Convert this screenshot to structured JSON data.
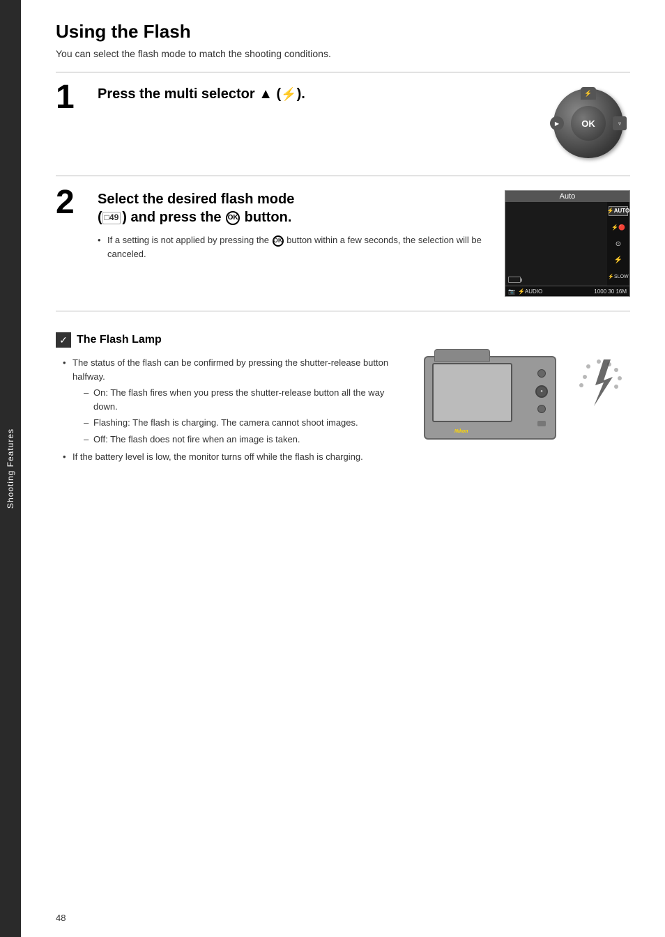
{
  "page": {
    "number": "48",
    "sidebar_label": "Shooting Features"
  },
  "title": "Using the Flash",
  "intro": "You can select the flash mode to match the shooting conditions.",
  "step1": {
    "number": "1",
    "heading": "Press the multi selector ▲ (⚡).",
    "dial": {
      "ok_label": "OK",
      "flash_symbol": "⚡"
    }
  },
  "step2": {
    "number": "2",
    "heading_line1": "Select the desired flash mode",
    "heading_line2": "(□49) and press the ⓪K button.",
    "note": "If a setting is not applied by pressing the ⓪K button within a few seconds, the selection will be canceled.",
    "menu": {
      "header": "Auto",
      "options": [
        {
          "label": "⚡AUTO",
          "selected": true
        },
        {
          "label": "⚡🔴",
          "selected": false
        },
        {
          "label": "⊙",
          "selected": false
        },
        {
          "label": "⚡",
          "selected": false
        },
        {
          "label": "⚡SLOW",
          "selected": false
        }
      ]
    }
  },
  "flash_lamp": {
    "title": "The Flash Lamp",
    "bullets": [
      {
        "text": "The status of the flash can be confirmed by pressing the shutter-release button halfway.",
        "sub_items": [
          "On: The flash fires when you press the shutter-release button all the way down.",
          "Flashing: The flash is charging. The camera cannot shoot images.",
          "Off: The flash does not fire when an image is taken."
        ]
      },
      {
        "text": "If the battery level is low, the monitor turns off while the flash is charging.",
        "sub_items": []
      }
    ]
  }
}
